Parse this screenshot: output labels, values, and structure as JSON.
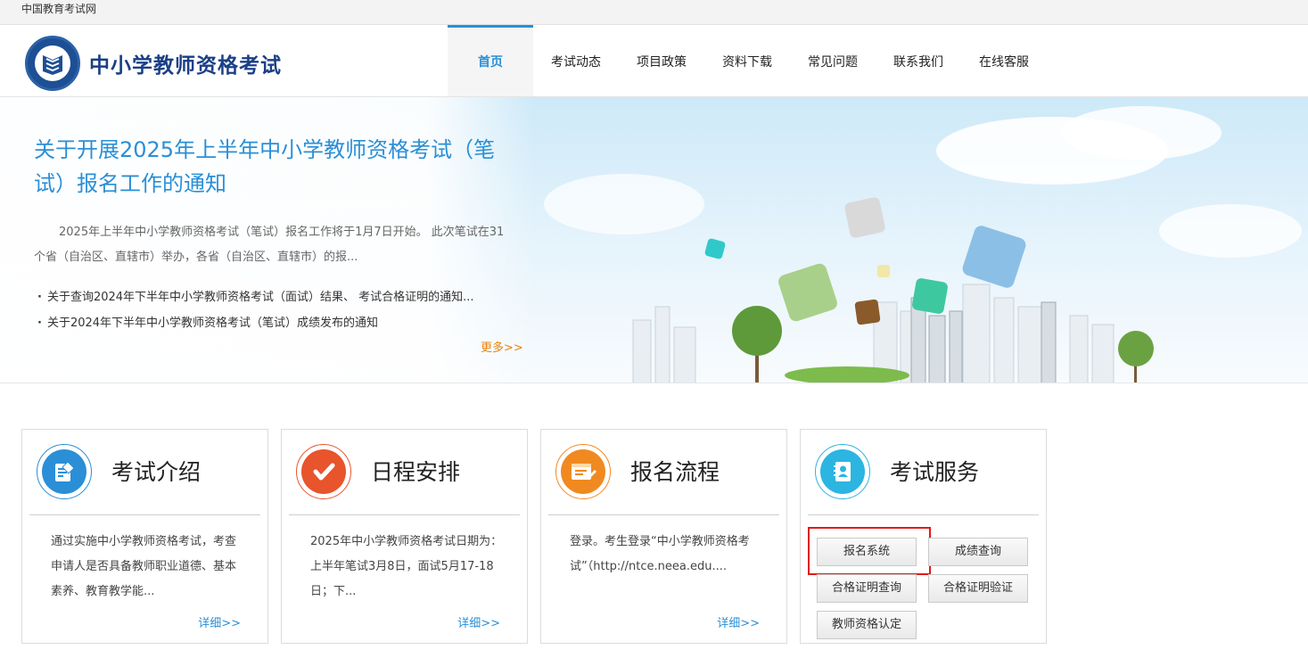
{
  "topbar": {
    "site_name": "中国教育考试网"
  },
  "header": {
    "logo_title": "中小学教师资格考试",
    "nav": [
      {
        "label": "首页",
        "active": true
      },
      {
        "label": "考试动态"
      },
      {
        "label": "项目政策"
      },
      {
        "label": "资料下载"
      },
      {
        "label": "常见问题"
      },
      {
        "label": "联系我们"
      },
      {
        "label": "在线客服"
      }
    ]
  },
  "banner": {
    "headline": "关于开展2025年上半年中小学教师资格考试（笔试）报名工作的通知",
    "summary": "2025年上半年中小学教师资格考试（笔试）报名工作将于1月7日开始。   此次笔试在31个省（自治区、直辖市）举办，各省（自治区、直辖市）的报...",
    "news": [
      "关于查询2024年下半年中小学教师资格考试（面试）结果、 考试合格证明的通知...",
      "关于2024年下半年中小学教师资格考试（笔试）成绩发布的通知"
    ],
    "more": "更多>>"
  },
  "cards": {
    "intro": {
      "title": "考试介绍",
      "body": "通过实施中小学教师资格考试，考查申请人是否具备教师职业道德、基本素养、教育教学能...",
      "detail": "详细>>"
    },
    "schedule": {
      "title": "日程安排",
      "body": "2025年中小学教师资格考试日期为：上半年笔试3月8日，面试5月17-18日；下...",
      "detail": "详细>>"
    },
    "process": {
      "title": "报名流程",
      "body": "登录。考生登录“中小学教师资格考试”（http://ntce.neea.edu....",
      "detail": "详细>>"
    },
    "services": {
      "title": "考试服务",
      "buttons": {
        "register": "报名系统",
        "score": "成绩查询",
        "cert_query": "合格证明查询",
        "cert_verify": "合格证明验证",
        "qualification": "教师资格认定"
      }
    }
  },
  "colors": {
    "accent": "#2a8fd6",
    "orange": "#e8820c",
    "highlight": "#e01a1a",
    "brand": "#1b3f86"
  }
}
